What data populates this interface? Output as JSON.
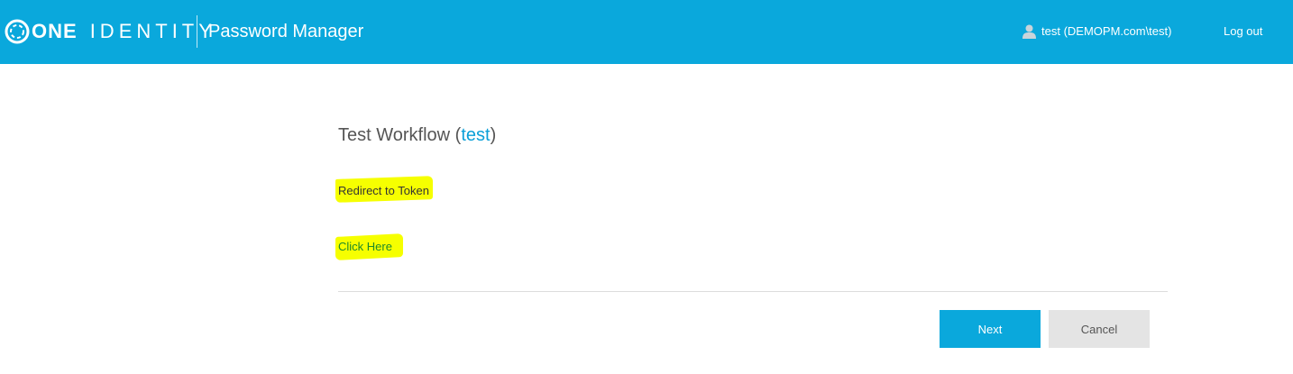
{
  "header": {
    "brand_one": "ONE",
    "brand_identity": "IDENTITY",
    "app_title": "Password Manager",
    "user_label": "test (DEMOPM.com\\test)",
    "logout_label": "Log out",
    "user_icon": "user-icon",
    "logo_icon": "one-identity-ring-icon",
    "bar_color": "#0aa8dc"
  },
  "main": {
    "title_text": "Test Workflow (",
    "title_link": "test",
    "title_close": ")",
    "redirect_text": "Redirect to Token",
    "click_here_label": "Click Here",
    "highlight_color": "#f6ff00",
    "link_color": "#0a9fd8"
  },
  "footer": {
    "next_label": "Next",
    "cancel_label": "Cancel"
  }
}
